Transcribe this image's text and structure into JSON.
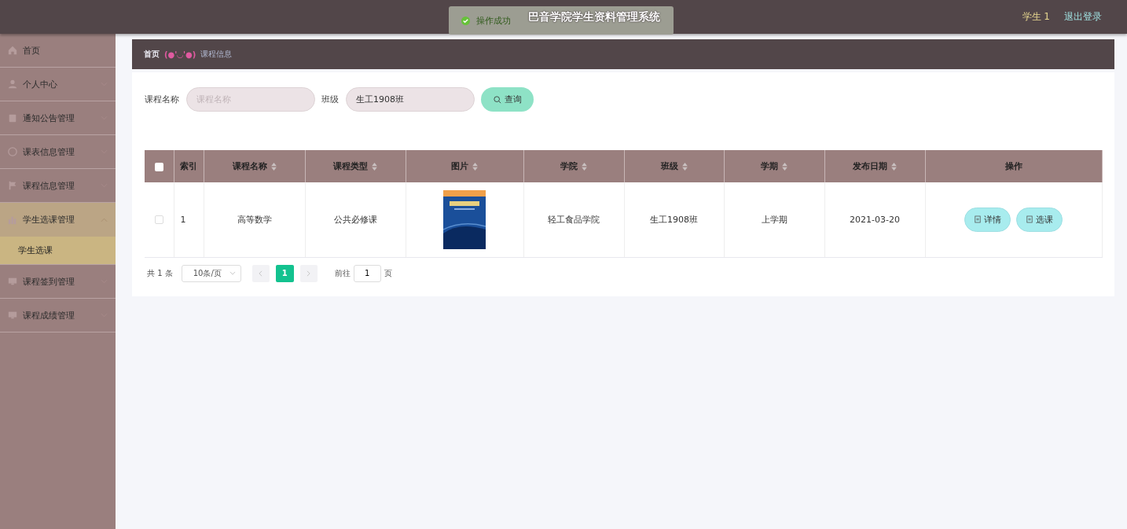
{
  "header": {
    "title": "巴音学院学生资料管理系统",
    "user": "学生 1",
    "logout": "退出登录"
  },
  "toast": {
    "message": "操作成功"
  },
  "sidebar": {
    "items": [
      {
        "label": "首页",
        "kind": "link",
        "expanded": false
      },
      {
        "label": "个人中心",
        "kind": "group",
        "expanded": false
      },
      {
        "label": "通知公告管理",
        "kind": "group",
        "expanded": false
      },
      {
        "label": "课表信息管理",
        "kind": "group",
        "expanded": false
      },
      {
        "label": "课程信息管理",
        "kind": "group",
        "expanded": false
      },
      {
        "label": "学生选课管理",
        "kind": "group",
        "expanded": true,
        "children": [
          {
            "label": "学生选课",
            "selected": true
          }
        ]
      },
      {
        "label": "课程签到管理",
        "kind": "group",
        "expanded": false
      },
      {
        "label": "课程成绩管理",
        "kind": "group",
        "expanded": false
      }
    ]
  },
  "breadcrumb": {
    "home": "首页",
    "emoticon": "(●'◡'●)",
    "current": "课程信息"
  },
  "search": {
    "fields": [
      {
        "label": "课程名称",
        "placeholder": "课程名称"
      },
      {
        "label": "班级",
        "value": "生工1908班"
      }
    ],
    "button": "查询"
  },
  "table": {
    "select_all": false,
    "columns": [
      {
        "label": "索引",
        "sortable": false
      },
      {
        "label": "课程名称",
        "sortable": true
      },
      {
        "label": "课程类型",
        "sortable": true
      },
      {
        "label": "图片",
        "sortable": true
      },
      {
        "label": "学院",
        "sortable": true
      },
      {
        "label": "班级",
        "sortable": true
      },
      {
        "label": "学期",
        "sortable": true
      },
      {
        "label": "发布日期",
        "sortable": true
      },
      {
        "label": "操作",
        "sortable": false
      }
    ],
    "rows": [
      {
        "checked": false,
        "index": "1",
        "name": "高等数学",
        "type": "公共必修课",
        "college": "轻工食品学院",
        "class": "生工1908班",
        "term": "上学期",
        "date": "2021-03-20",
        "actions": [
          "详情",
          "选课"
        ]
      }
    ]
  },
  "pagination": {
    "total": "共 1 条",
    "page_size": "10条/页",
    "pages": [
      {
        "label": "1",
        "selected": true
      }
    ],
    "goto_label": "前往",
    "goto_value": "1",
    "goto_suffix": "页"
  }
}
